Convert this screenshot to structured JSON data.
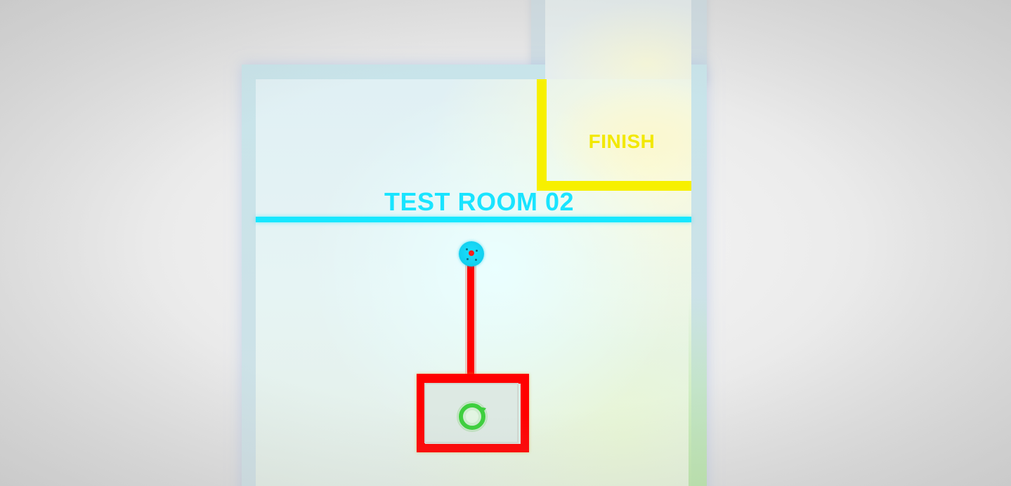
{
  "room": {
    "title": "TEST ROOM 02",
    "finish_label": "FINISH"
  },
  "colors": {
    "title": "#1ae4ff",
    "divider": "#17e7ff",
    "finish": "#f7f000",
    "lever": "#ff0000",
    "knob": "#1be0ff",
    "player": "#3ecf3e"
  },
  "icons": {
    "player": "green-ring-player-icon",
    "knob": "cyan-knob-icon"
  }
}
